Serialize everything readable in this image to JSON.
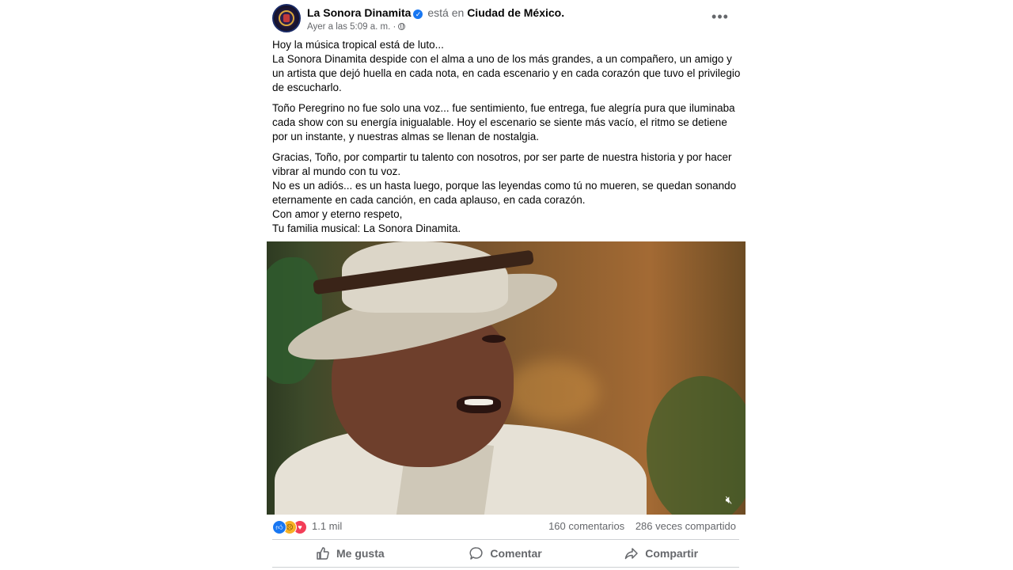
{
  "post": {
    "author": "La Sonora Dinamita",
    "verified": true,
    "location_prefix": "está en",
    "location": "Ciudad de México.",
    "timestamp": "Ayer a las 5:09 a. m. ·",
    "more_icon": "more-horizontal-icon",
    "paragraphs": [
      {
        "lines": [
          "Hoy la música tropical está de luto...",
          "La Sonora Dinamita despide con el alma a uno de los más grandes, a un compañero, un amigo y un artista que dejó huella en cada nota, en cada escenario y en cada corazón que tuvo el privilegio de escucharlo."
        ]
      },
      {
        "lines": [
          "Toño Peregrino no fue solo una voz... fue sentimiento, fue entrega, fue alegría pura que iluminaba cada show con su energía inigualable. Hoy el escenario se siente más vacío, el ritmo se detiene por un instante, y nuestras almas se llenan de nostalgia."
        ]
      },
      {
        "lines": [
          "Gracias, Toño, por compartir tu talento con nosotros, por ser parte de nuestra historia y por hacer vibrar al mundo con tu voz.",
          "No es un adiós... es un hasta luego, porque las leyendas como tú no mueren, se quedan sonando eternamente en cada canción, en cada aplauso, en cada corazón.",
          "Con amor y eterno respeto,",
          "Tu familia musical: La Sonora Dinamita."
        ]
      }
    ]
  },
  "media": {
    "mute_icon": "volume-muted-icon"
  },
  "stats": {
    "reactions": [
      "like",
      "sad",
      "love"
    ],
    "reaction_count": "1.1 mil",
    "comments": "160 comentarios",
    "shares": "286 veces compartido"
  },
  "actions": {
    "like": "Me gusta",
    "comment": "Comentar",
    "share": "Compartir"
  },
  "colors": {
    "brand_blue": "#1877f2",
    "muted_text": "#65676b",
    "divider": "#ced0d4"
  }
}
